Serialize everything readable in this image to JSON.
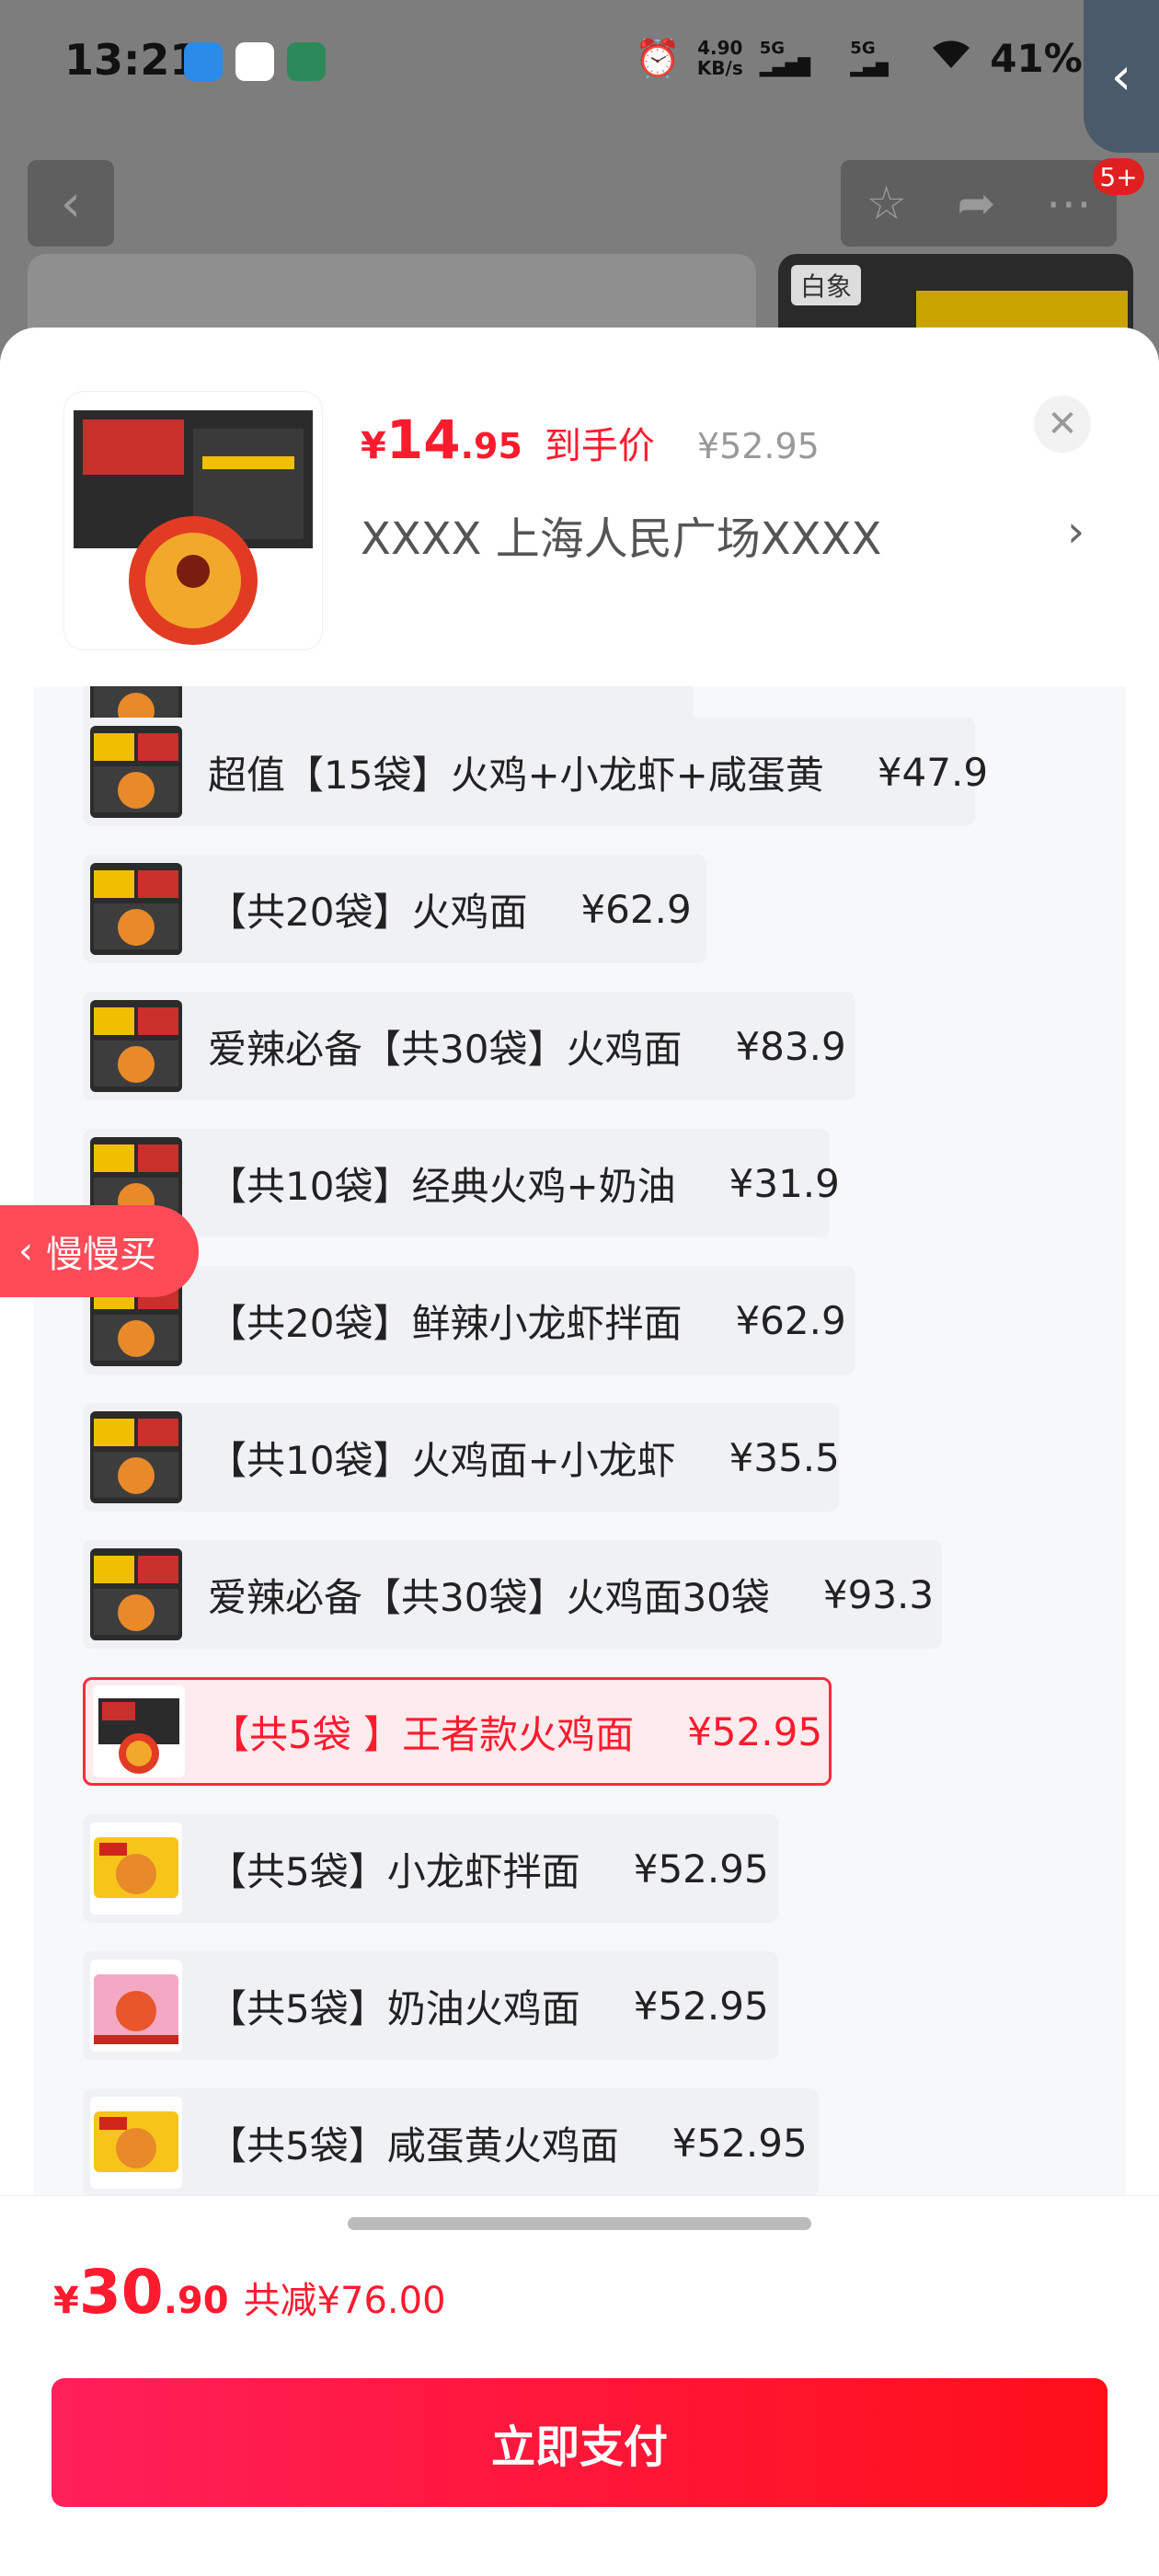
{
  "status_bar": {
    "time": "13:21",
    "speed": "4.90",
    "speed_unit": "KB/s",
    "signal1": "5G",
    "signal2": "5G",
    "battery": "41%",
    "icons": [
      "alarm-icon",
      "signal-icon",
      "wifi-icon",
      "battery-icon"
    ]
  },
  "background": {
    "badge": "5+",
    "thumb_label": "白象"
  },
  "sheet": {
    "price_symbol": "¥",
    "price_int": "14",
    "price_dec": ".95",
    "price_tag": "到手价",
    "original_price": "¥52.95",
    "store": "XXXX 上海人民广场XXXX",
    "options": [
      {
        "label": "",
        "price": "",
        "selected": false,
        "style": "combo"
      },
      {
        "label": "超值【15袋】火鸡+小龙虾+咸蛋黄",
        "price": "¥47.9",
        "selected": false,
        "style": "combo"
      },
      {
        "label": "【共20袋】火鸡面",
        "price": "¥62.9",
        "selected": false,
        "style": "combo"
      },
      {
        "label": "爱辣必备【共30袋】火鸡面",
        "price": "¥83.9",
        "selected": false,
        "style": "combo"
      },
      {
        "label": "【共10袋】经典火鸡+奶油",
        "price": "¥31.9",
        "selected": false,
        "style": "combo"
      },
      {
        "label": "【共20袋】鲜辣小龙虾拌面",
        "price": "¥62.9",
        "selected": false,
        "style": "combo"
      },
      {
        "label": "【共10袋】火鸡面+小龙虾",
        "price": "¥35.5",
        "selected": false,
        "style": "combo"
      },
      {
        "label": "爱辣必备【共30袋】火鸡面30袋",
        "price": "¥93.3",
        "selected": false,
        "style": "combo"
      },
      {
        "label": "【共5袋 】王者款火鸡面",
        "price": "¥52.95",
        "selected": true,
        "style": "king"
      },
      {
        "label": "【共5袋】小龙虾拌面",
        "price": "¥52.95",
        "selected": false,
        "style": "yellow"
      },
      {
        "label": "【共5袋】奶油火鸡面",
        "price": "¥52.95",
        "selected": false,
        "style": "pink"
      },
      {
        "label": "【共5袋】咸蛋黄火鸡面",
        "price": "¥52.95",
        "selected": false,
        "style": "yellow"
      }
    ],
    "slow_buy": "慢慢买",
    "total_symbol": "¥",
    "total_int": "30",
    "total_dec": ".90",
    "discount": "共减¥76.00",
    "pay_button": "立即支付"
  },
  "colors": {
    "accent": "#ff1a2e",
    "pay_gradient_start": "#ff1f5a",
    "pay_gradient_end": "#ff0f18",
    "selected_bg": "#fdebee"
  }
}
